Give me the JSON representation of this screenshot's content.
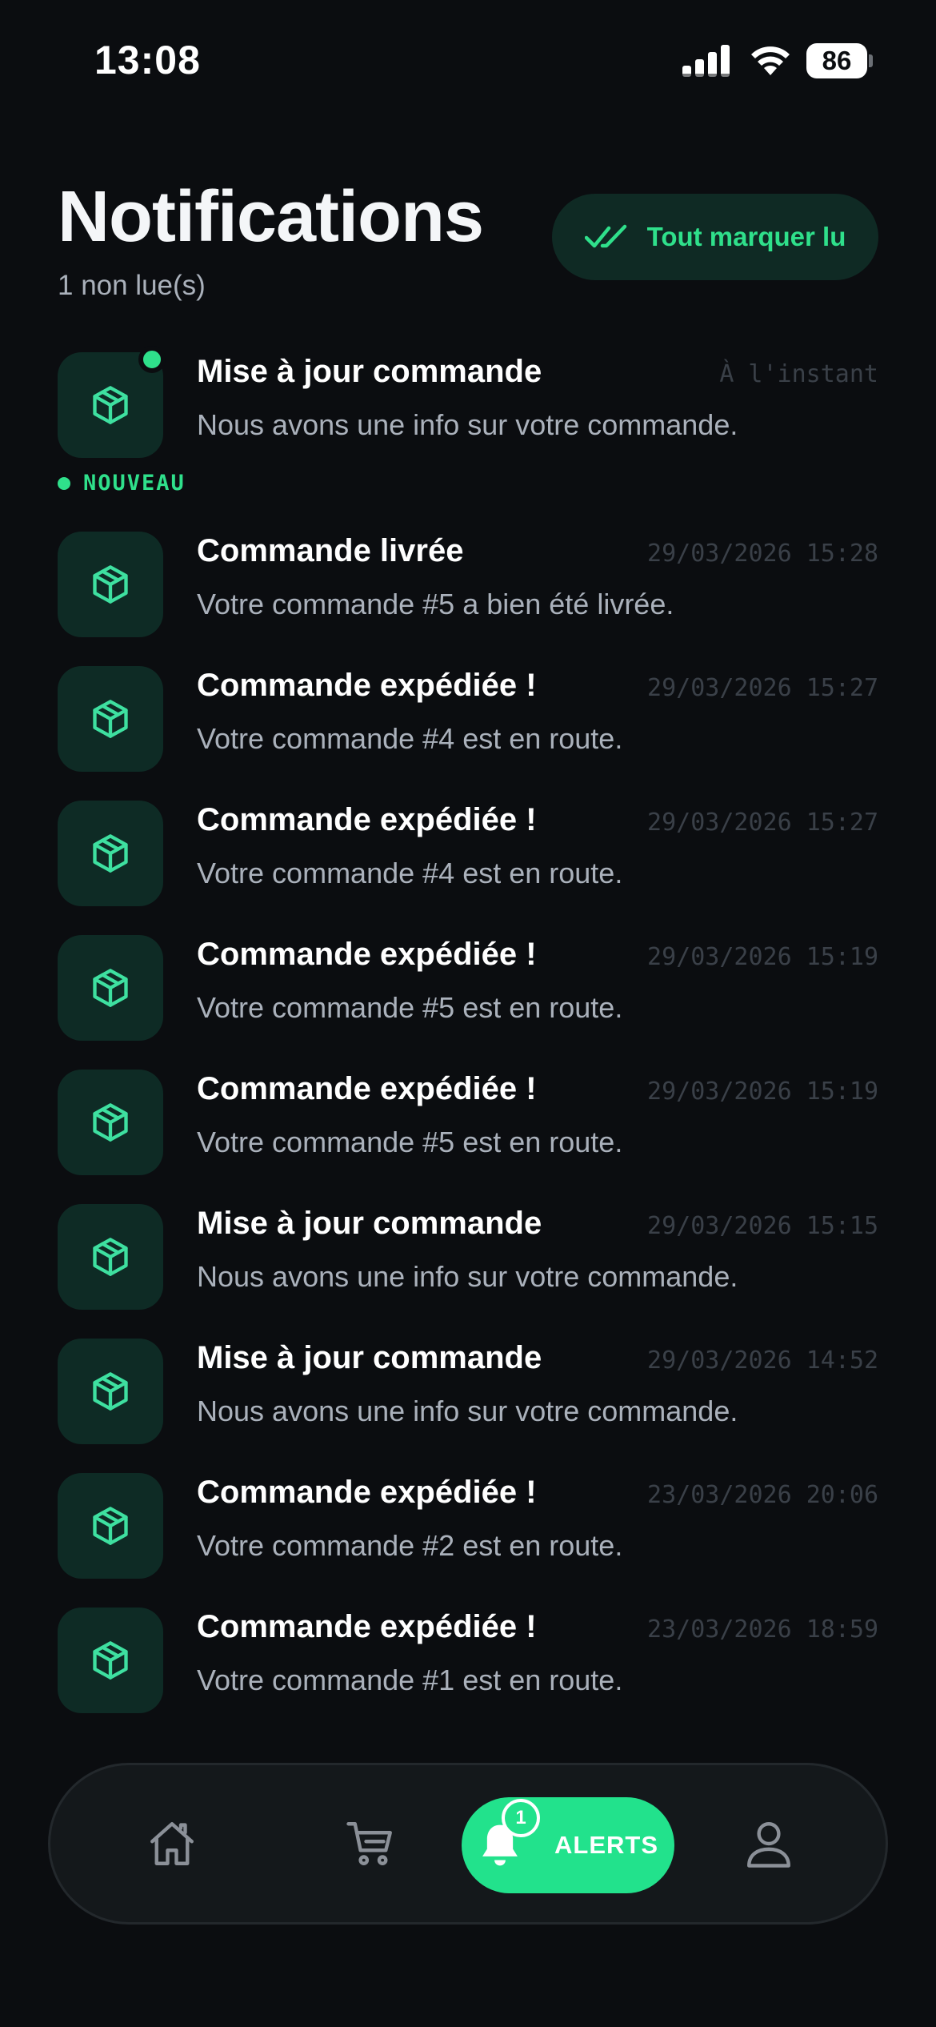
{
  "status_bar": {
    "time": "13:08",
    "battery": "86"
  },
  "header": {
    "title": "Notifications",
    "unread_count": "1 non lue(s)",
    "mark_all_label": "Tout marquer lu"
  },
  "new_badge_label": "NOUVEAU",
  "notifications": [
    {
      "title": "Mise à jour commande",
      "body": "Nous avons une info sur votre commande.",
      "time": "À l'instant",
      "unread": true,
      "icon": "package-icon"
    },
    {
      "title": "Commande livrée",
      "body": "Votre commande #5 a bien été livrée.",
      "time": "29/03/2026 15:28",
      "unread": false,
      "icon": "package-icon"
    },
    {
      "title": "Commande expédiée !",
      "body": "Votre commande #4 est en route.",
      "time": "29/03/2026 15:27",
      "unread": false,
      "icon": "package-icon"
    },
    {
      "title": "Commande expédiée !",
      "body": "Votre commande #4 est en route.",
      "time": "29/03/2026 15:27",
      "unread": false,
      "icon": "package-icon"
    },
    {
      "title": "Commande expédiée !",
      "body": "Votre commande #5 est en route.",
      "time": "29/03/2026 15:19",
      "unread": false,
      "icon": "package-icon"
    },
    {
      "title": "Commande expédiée !",
      "body": "Votre commande #5 est en route.",
      "time": "29/03/2026 15:19",
      "unread": false,
      "icon": "package-icon"
    },
    {
      "title": "Mise à jour commande",
      "body": "Nous avons une info sur votre commande.",
      "time": "29/03/2026 15:15",
      "unread": false,
      "icon": "package-icon"
    },
    {
      "title": "Mise à jour commande",
      "body": "Nous avons une info sur votre commande.",
      "time": "29/03/2026 14:52",
      "unread": false,
      "icon": "package-icon"
    },
    {
      "title": "Commande expédiée !",
      "body": "Votre commande #2 est en route.",
      "time": "23/03/2026 20:06",
      "unread": false,
      "icon": "package-icon"
    },
    {
      "title": "Commande expédiée !",
      "body": "Votre commande #1 est en route.",
      "time": "23/03/2026 18:59",
      "unread": false,
      "icon": "package-icon"
    }
  ],
  "bottom_nav": {
    "items": [
      {
        "icon": "home-icon",
        "active": false
      },
      {
        "icon": "cart-icon",
        "active": false
      },
      {
        "icon": "bell-icon",
        "label": "ALERTS",
        "badge": "1",
        "active": true
      },
      {
        "icon": "user-icon",
        "active": false
      }
    ]
  },
  "colors": {
    "background": "#0b0d10",
    "accent": "#2fe08b",
    "active_tab": "#22e28c",
    "icon_tile": "#0e2b25"
  }
}
